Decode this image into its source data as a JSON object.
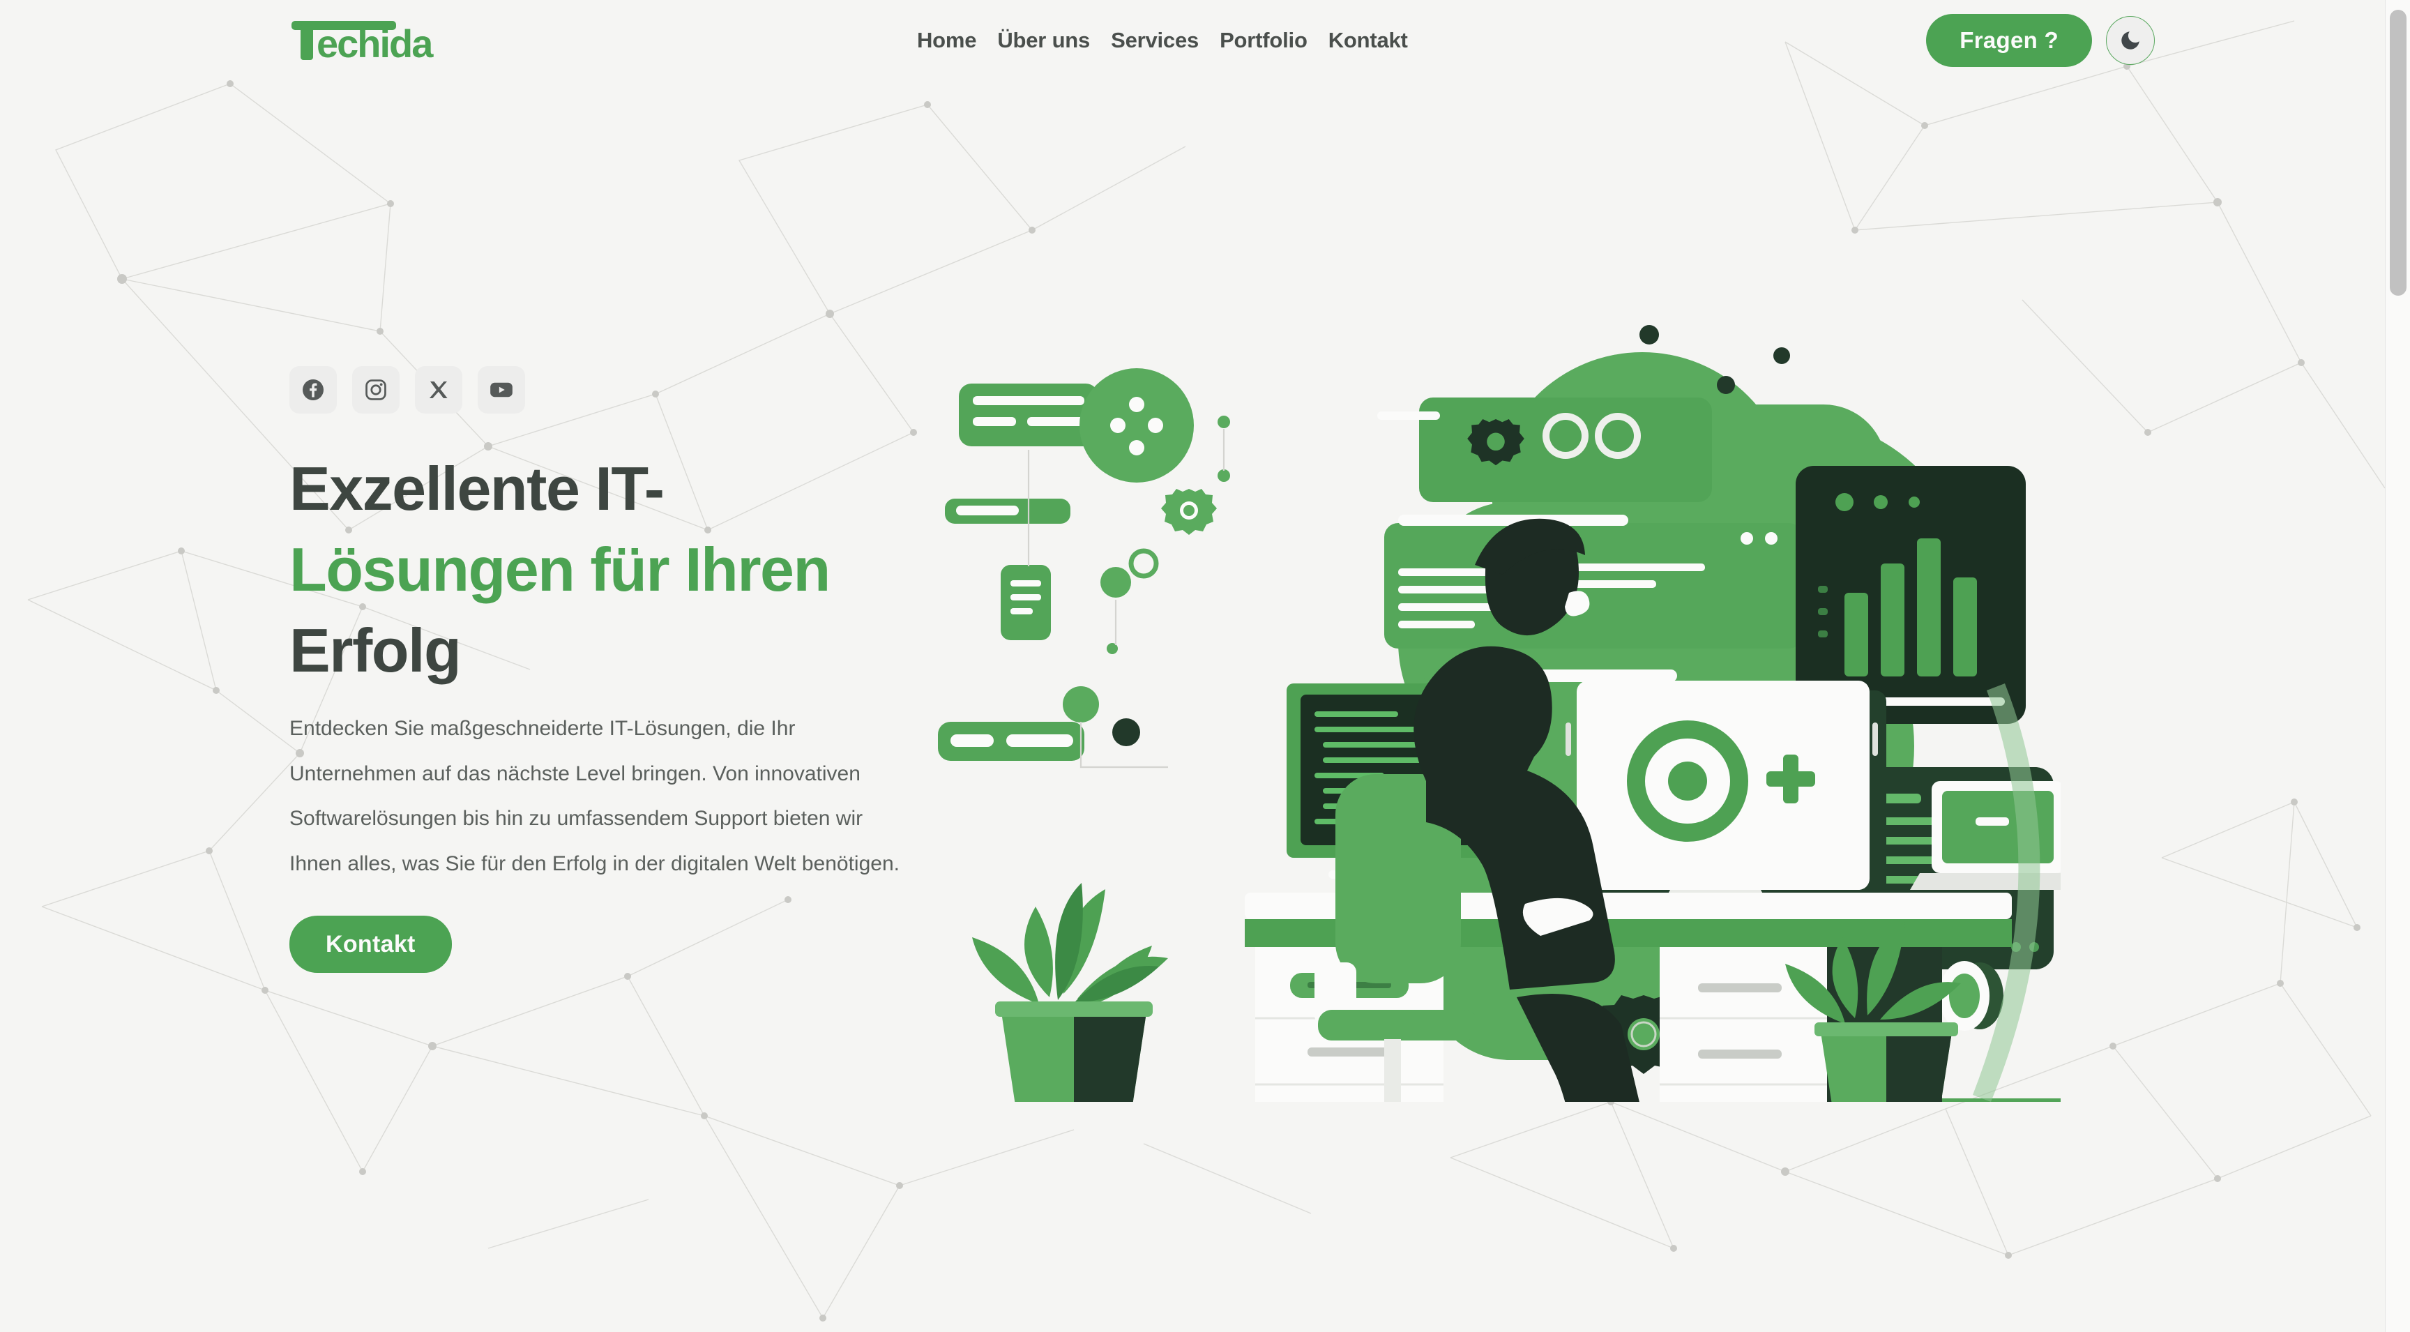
{
  "brand": {
    "name": "Techida",
    "color": "#4ca353"
  },
  "header": {
    "nav": [
      {
        "label": "Home"
      },
      {
        "label": "Über uns"
      },
      {
        "label": "Services"
      },
      {
        "label": "Portfolio"
      },
      {
        "label": "Kontakt"
      }
    ],
    "ask_button": "Fragen ?",
    "theme_toggle_icon": "moon-icon"
  },
  "hero": {
    "social": [
      {
        "name": "facebook",
        "icon": "facebook-icon"
      },
      {
        "name": "instagram",
        "icon": "instagram-icon"
      },
      {
        "name": "x-twitter",
        "icon": "x-icon"
      },
      {
        "name": "youtube",
        "icon": "youtube-icon"
      }
    ],
    "headline_line1": "Exzellente IT-",
    "headline_accent": "Lösungen für Ihren",
    "headline_line3": "Erfolg",
    "paragraph": "Entdecken Sie maßgeschneiderte IT-Lösungen, die Ihr Unternehmen auf das nächste Level bringen. Von innovativen Softwarelösungen bis hin zu umfassendem Support bieten wir Ihnen alles, was Sie für den Erfolg in der digitalen Welt benötigen.",
    "cta_button": "Kontakt",
    "illustration_alt": "developer-at-desk-illustration"
  },
  "colors": {
    "background": "#f5f5f3",
    "accent": "#4ca353",
    "heading": "#3e4641",
    "body_text": "#5b605d",
    "nav_text": "#4a4f4c",
    "social_chip": "#ededec",
    "dark_green": "#223a28",
    "mid_green": "#5aab5e"
  }
}
